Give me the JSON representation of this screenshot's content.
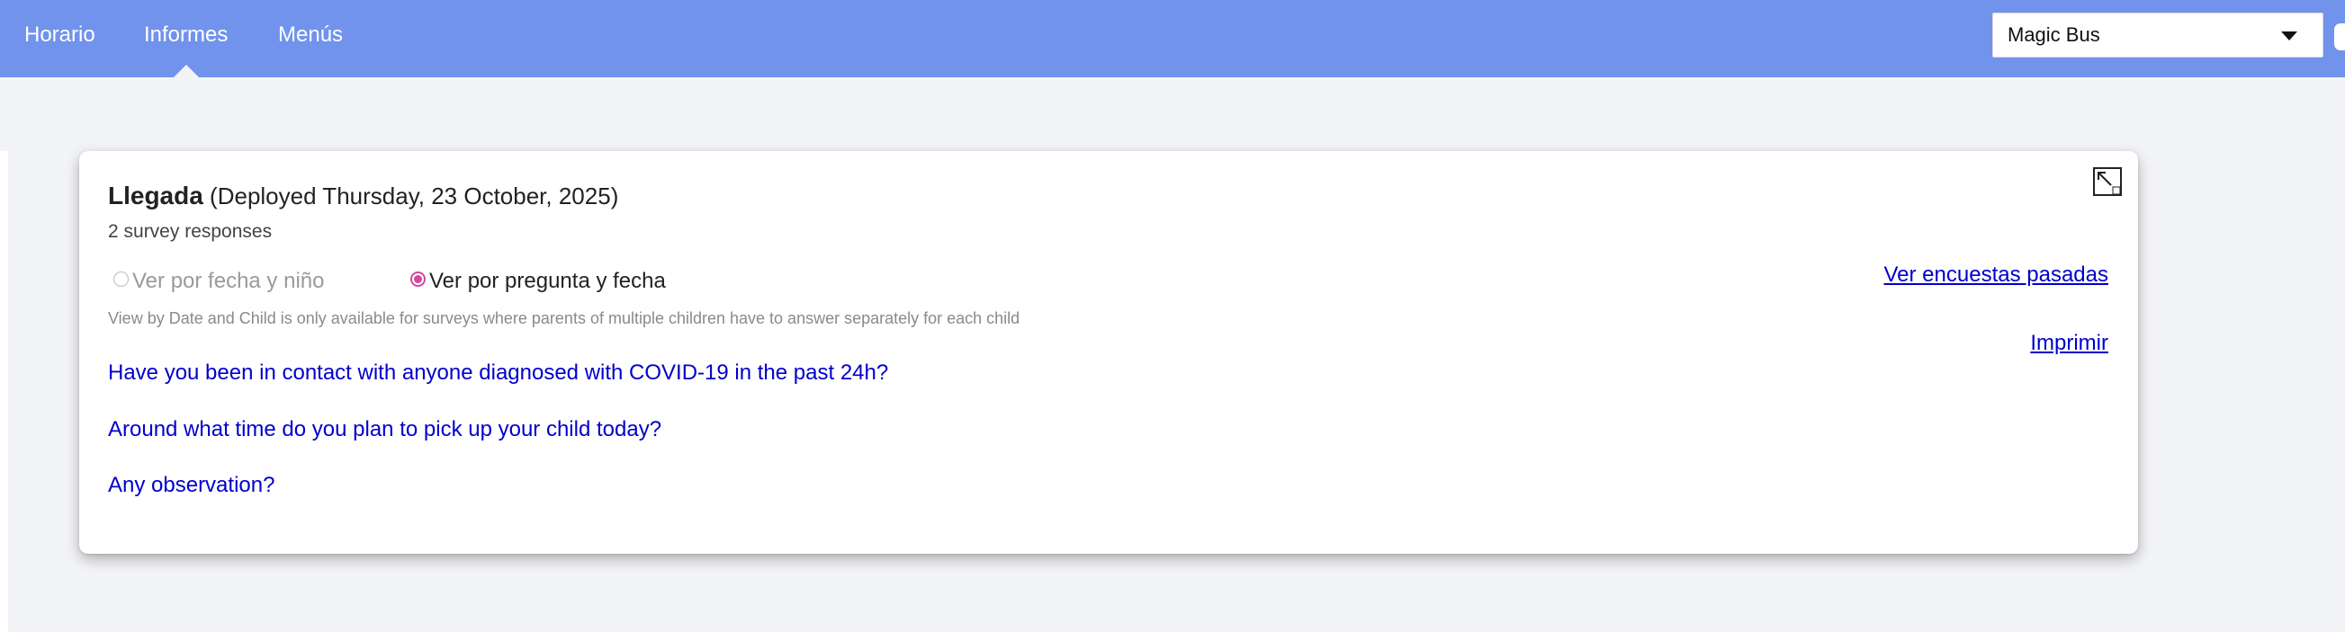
{
  "nav": {
    "items": [
      {
        "label": "Horario"
      },
      {
        "label": "Informes",
        "active": true
      },
      {
        "label": "Menús"
      }
    ]
  },
  "school_select": {
    "value": "Magic Bus"
  },
  "survey": {
    "name": "Llegada",
    "deployed": "(Deployed Thursday, 23 October, 2025)",
    "responses": "2 survey responses",
    "view_options": [
      {
        "label": "Ver por fecha y niño",
        "checked": false,
        "disabled": true
      },
      {
        "label": "Ver por pregunta y fecha",
        "checked": true,
        "disabled": false
      }
    ],
    "note": "View by Date and Child is only available for surveys where parents of multiple children have to answer separately for each child",
    "past_surveys_link": "Ver encuestas pasadas",
    "print_link": "Imprimir",
    "questions": [
      {
        "text": "Have you been in contact with anyone diagnosed with COVID-19 in the past 24h?"
      },
      {
        "text": "Around what time do you plan to pick up your child today?"
      },
      {
        "text": "Any observation?"
      }
    ]
  },
  "colors": {
    "header_bg": "#7193ec",
    "page_bg": "#f3f4f8",
    "link": "#0000cc",
    "radio_accent": "#d4479a"
  },
  "icons": {
    "expand": "expand-icon",
    "dropdown": "caret-down-icon"
  }
}
